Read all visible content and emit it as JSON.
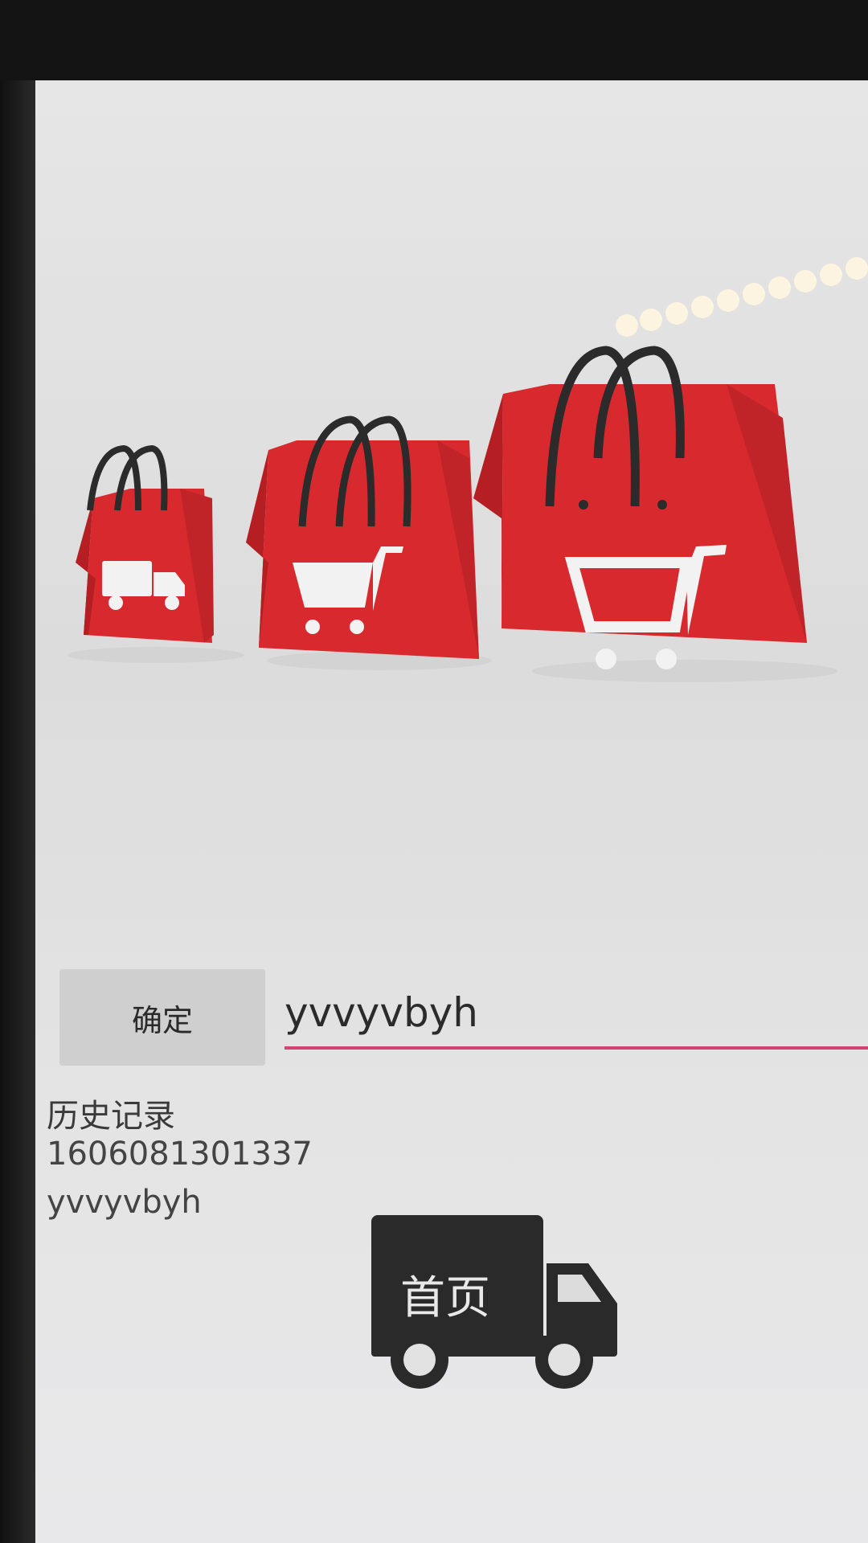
{
  "banner": {
    "bags": [
      {
        "icon": "truck-icon"
      },
      {
        "icon": "cart-icon"
      },
      {
        "icon": "cart-icon"
      }
    ],
    "colors": {
      "bag": "#d82a2e",
      "handle": "#2b2b2b"
    }
  },
  "search": {
    "button_label": "确定",
    "input_value": "yvvyvbyh",
    "underline_color": "#d2416f"
  },
  "history": {
    "title": "历史记录",
    "items": [
      "1606081301337",
      "yvvyvbyh"
    ]
  },
  "home_button": {
    "label": "首页",
    "icon": "truck-icon",
    "color": "#2a2a2a"
  }
}
